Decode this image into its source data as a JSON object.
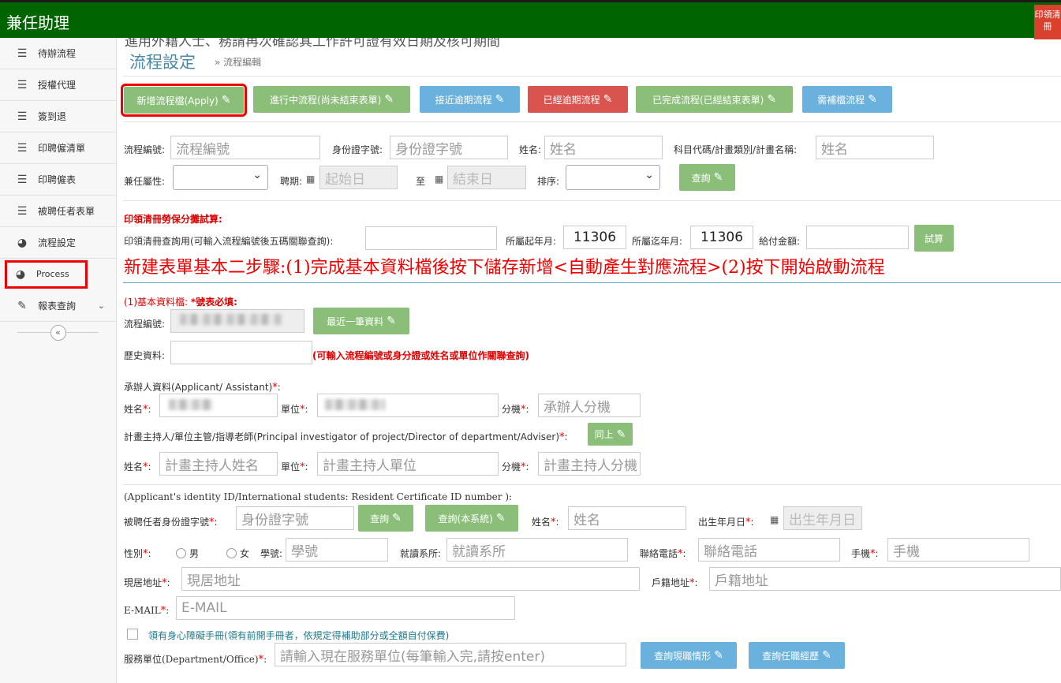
{
  "app": {
    "title": "兼任助理",
    "corner_label": "印領清冊"
  },
  "sidebar": {
    "items": [
      {
        "label": "待辦流程",
        "icon": "menu-icon"
      },
      {
        "label": "授權代理",
        "icon": "menu-icon"
      },
      {
        "label": "簽到退",
        "icon": "menu-icon"
      },
      {
        "label": "印聘僱清單",
        "icon": "menu-icon"
      },
      {
        "label": "印聘僱表",
        "icon": "menu-icon"
      },
      {
        "label": "被聘任者表單",
        "icon": "menu-icon"
      },
      {
        "label": "流程設定",
        "icon": "dashboard-icon"
      },
      {
        "label": "Process",
        "icon": "dashboard-icon"
      },
      {
        "label": "報表查詢",
        "icon": "edit-icon"
      }
    ],
    "collapse_glyph": "«"
  },
  "header": {
    "cutoff_text": "進用外籍人士、務請再次確認其工作許可證有效日期及核可期間",
    "title": "流程設定",
    "breadcrumb": "» 流程編輯"
  },
  "toolbar": {
    "new_flow": "新增流程檔(Apply)",
    "in_progress": "進行中流程(尚未結束表單)",
    "near_due": "接近逾期流程",
    "overdue": "已經逾期流程",
    "completed": "已完成流程(已經結束表單)",
    "supplement": "需補檔流程"
  },
  "search": {
    "flow_no_label": "流程編號:",
    "flow_no_placeholder": "流程編號",
    "id_label": "身份證字號:",
    "id_placeholder": "身份證字號",
    "name_label": "姓名:",
    "name_placeholder": "姓名",
    "subject_label": "科目代碼/計畫類別/計畫名稱:",
    "subject_placeholder": "姓名",
    "type_label": "兼任屬性:",
    "period_label": "聘期:",
    "start_placeholder": "起始日",
    "to_label": "至",
    "end_placeholder": "結束日",
    "sort_label": "排序:",
    "query_button": "查詢"
  },
  "calc": {
    "section_title": "印領清冊勞保分攤試算:",
    "query_label": "印領清冊查詢用(可輸入流程編號後五碼關聯查詢):",
    "from_label": "所屬起年月:",
    "from_value": "11306",
    "to_label": "所屬迄年月:",
    "to_value": "11306",
    "amount_label": "給付金額:",
    "try_button": "試算"
  },
  "steps_banner": "新建表單基本二步驟:(1)完成基本資料檔後按下儲存新增<自動產生對應流程>(2)按下開始啟動流程",
  "basic": {
    "section_title": "(1)基本資料檔: ",
    "required_note": "號表必填:",
    "flow_no_label": "流程編號:",
    "latest_button": "最近一筆資料",
    "history_label": "歷史資料:",
    "history_hint": "(可輸入流程編號或身分證或姓名或單位作關聯查詢)"
  },
  "applicant": {
    "section_label": "承辦人資料(Applicant/ Assistant)",
    "name_label": "姓名",
    "unit_label": "單位",
    "ext_label": "分機",
    "ext_placeholder": "承辦人分機"
  },
  "principal": {
    "section_label": "計畫主持人/單位主管/指導老師(Principal investigator of project/Director of department/Adviser)",
    "same_button": "同上",
    "name_label": "姓名",
    "name_placeholder": "計畫主持人姓名",
    "unit_label": "單位",
    "unit_placeholder": "計畫主持人單位",
    "ext_label": "分機",
    "ext_placeholder": "計畫主持人分機"
  },
  "appointee": {
    "id_note": "(Applicant's identity ID/International students: Resident Certificate ID number ):",
    "id_label": "被聘任者身份證字號",
    "id_placeholder": "身份證字號",
    "query_button": "查詢",
    "query_local_button": "查詢(本系統)",
    "name_label": "姓名",
    "name_placeholder": "姓名",
    "birth_label": "出生年月日",
    "birth_placeholder": "出生年月日",
    "gender_label": "性別",
    "male": "男",
    "female": "女",
    "student_no_label": "學號:",
    "student_no_placeholder": "學號",
    "dept_label": "就讀系所:",
    "dept_placeholder": "就讀系所",
    "phone_label": "聯絡電話",
    "phone_placeholder": "聯絡電話",
    "mobile_label": "手機",
    "mobile_placeholder": "手機",
    "address_label": "現居地址",
    "address_placeholder": "現居地址",
    "domicile_label": "戶籍地址",
    "domicile_placeholder": "戶籍地址",
    "email_label": "E-MAIL",
    "email_placeholder": "E-MAIL",
    "disability_text": "領有身心障礙手冊(領有前開手冊者，依規定得補助部分或全額自付保費)",
    "service_label": "服務單位(Department/Office)",
    "service_placeholder": "請輸入現在服務單位(每筆輸入完,請按enter)",
    "current_job_button": "查詢現職情形",
    "job_history_button": "查詢任職經歷"
  }
}
